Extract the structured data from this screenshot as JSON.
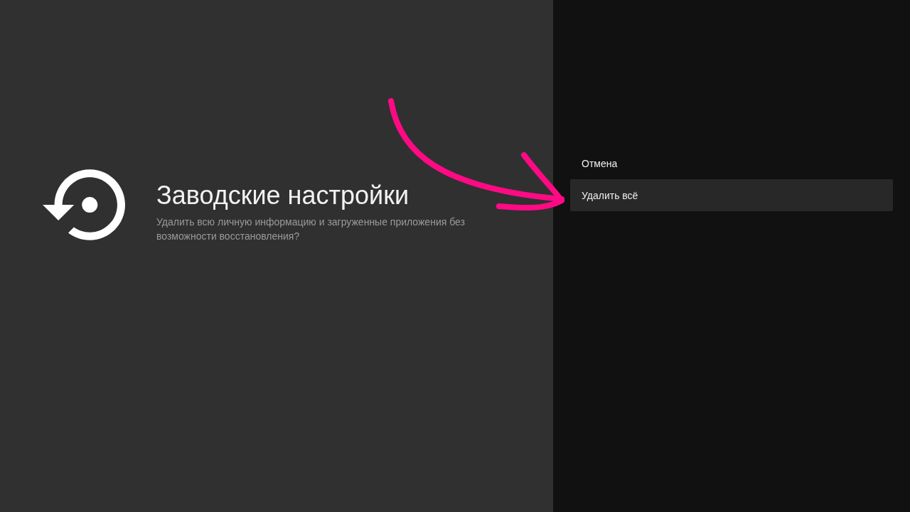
{
  "guidance": {
    "title": "Заводские настройки",
    "description": "Удалить всю личную информацию и загруженные приложения без возможности восстановления?"
  },
  "actions": [
    {
      "label": "Отмена",
      "selected": false
    },
    {
      "label": "Удалить всё",
      "selected": true
    }
  ]
}
